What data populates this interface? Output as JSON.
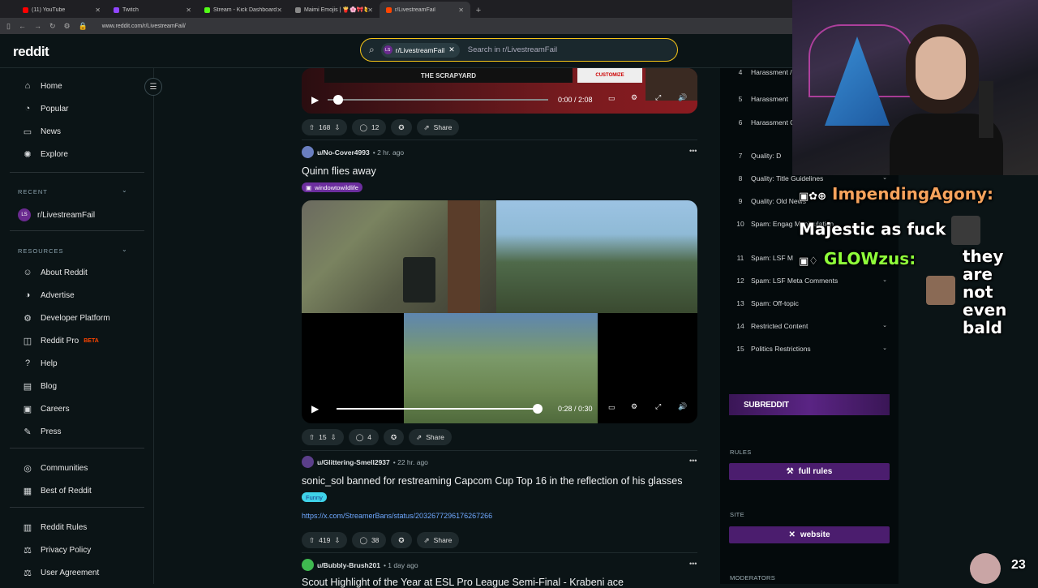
{
  "browser": {
    "tabs": [
      {
        "label": "(11) YouTube",
        "color": "#ff0000"
      },
      {
        "label": "Twitch",
        "color": "#9146ff"
      },
      {
        "label": "Stream - Kick Dashboard",
        "color": "#53fc18"
      },
      {
        "label": "Maimi Emojis | 🍟🌸🎀🐱 | Copy",
        "color": "#888888"
      },
      {
        "label": "r/LivestreamFail",
        "color": "#ff4500"
      }
    ],
    "url": "www.reddit.com/r/LivestreamFail/"
  },
  "header": {
    "logo": "reddit",
    "search_chip": "r/LivestreamFail",
    "search_chip_icon": "LS",
    "search_placeholder": "Search in r/LivestreamFail"
  },
  "sidebar": {
    "main": [
      {
        "label": "Home",
        "icon": "home-icon",
        "glyph": "⌂"
      },
      {
        "label": "Popular",
        "icon": "popular-icon",
        "glyph": "◔"
      },
      {
        "label": "News",
        "icon": "news-icon",
        "glyph": "▭"
      },
      {
        "label": "Explore",
        "icon": "explore-icon",
        "glyph": "✺"
      }
    ],
    "recent_heading": "RECENT",
    "recent": [
      {
        "label": "r/LivestreamFail",
        "icon": "LS"
      }
    ],
    "resources_heading": "RESOURCES",
    "resources": [
      {
        "label": "About Reddit",
        "icon": "about-icon",
        "glyph": "☺"
      },
      {
        "label": "Advertise",
        "icon": "advertise-icon",
        "glyph": "◑"
      },
      {
        "label": "Developer Platform",
        "icon": "developer-icon",
        "glyph": "⚙"
      },
      {
        "label": "Reddit Pro",
        "icon": "reddit-pro-icon",
        "glyph": "◫",
        "badge": "BETA"
      },
      {
        "label": "Help",
        "icon": "help-icon",
        "glyph": "?"
      },
      {
        "label": "Blog",
        "icon": "blog-icon",
        "glyph": "▤"
      },
      {
        "label": "Careers",
        "icon": "careers-icon",
        "glyph": "▣"
      },
      {
        "label": "Press",
        "icon": "press-icon",
        "glyph": "✎"
      }
    ],
    "communities": [
      {
        "label": "Communities",
        "icon": "communities-icon",
        "glyph": "◎"
      },
      {
        "label": "Best of Reddit",
        "icon": "best-of-icon",
        "glyph": "▦"
      }
    ],
    "legal": [
      {
        "label": "Reddit Rules",
        "icon": "rules-icon",
        "glyph": "▥"
      },
      {
        "label": "Privacy Policy",
        "icon": "privacy-icon",
        "glyph": "⚖"
      },
      {
        "label": "User Agreement",
        "icon": "agreement-icon",
        "glyph": "⚖"
      }
    ]
  },
  "feed": {
    "top_post": {
      "video_caption_left": "THE SCRAPYARD",
      "video_caption_right": "CUSTOMIZE",
      "time": "0:00 / 2:08",
      "progress": 0,
      "votes": "168",
      "comments": "12",
      "share": "Share"
    },
    "post1": {
      "user": "u/No-Cover4993",
      "time": "2 hr. ago",
      "title": "Quinn flies away",
      "flair": "windowtowildlife",
      "video_time": "0:28 / 0:30",
      "progress": 0.93,
      "votes": "15",
      "comments": "4",
      "share": "Share"
    },
    "post2": {
      "user": "u/Glittering-Smell2937",
      "time": "22 hr. ago",
      "title": "sonic_sol banned for restreaming Capcom Cup Top 16 in the reflection of his glasses",
      "flair": "Funny",
      "link": "https://x.com/StreamerBans/status/2032677296176267266",
      "votes": "419",
      "comments": "38",
      "share": "Share"
    },
    "post3": {
      "user": "u/Bubbly-Brush201",
      "time": "1 day ago",
      "title": "Scout Highlight of the Year at ESL Pro League Semi-Final - Krabeni ace"
    }
  },
  "right_sidebar": {
    "rules": [
      {
        "n": "4",
        "t": "Harassment / Allegation"
      },
      {
        "n": "5",
        "t": "Harassment"
      },
      {
        "n": "6",
        "t": "Harassment Content"
      },
      {
        "n": "7",
        "t": "Quality: D"
      },
      {
        "n": "8",
        "t": "Quality: Title Guidelines"
      },
      {
        "n": "9",
        "t": "Quality: Old News"
      },
      {
        "n": "10",
        "t": "Spam: Engag Manipulation"
      },
      {
        "n": "11",
        "t": "Spam: LSF M"
      },
      {
        "n": "12",
        "t": "Spam: LSF Meta Comments"
      },
      {
        "n": "13",
        "t": "Spam: Off-topic"
      },
      {
        "n": "14",
        "t": "Restricted Content"
      },
      {
        "n": "15",
        "t": "Politics Restrictions"
      }
    ],
    "subreddit_banner": "SUBREDDIT",
    "rules_heading": "RULES",
    "rules_button": "full rules",
    "site_heading": "SITE",
    "site_button": "website",
    "moderators_heading": "MODERATORS"
  },
  "overlay": {
    "chat": [
      {
        "user": "ImpendingAgony:",
        "message": "Majestic as fuck"
      },
      {
        "user": "GLOWzus:",
        "message": "they are not even bald"
      }
    ],
    "viewer_count": "23"
  }
}
